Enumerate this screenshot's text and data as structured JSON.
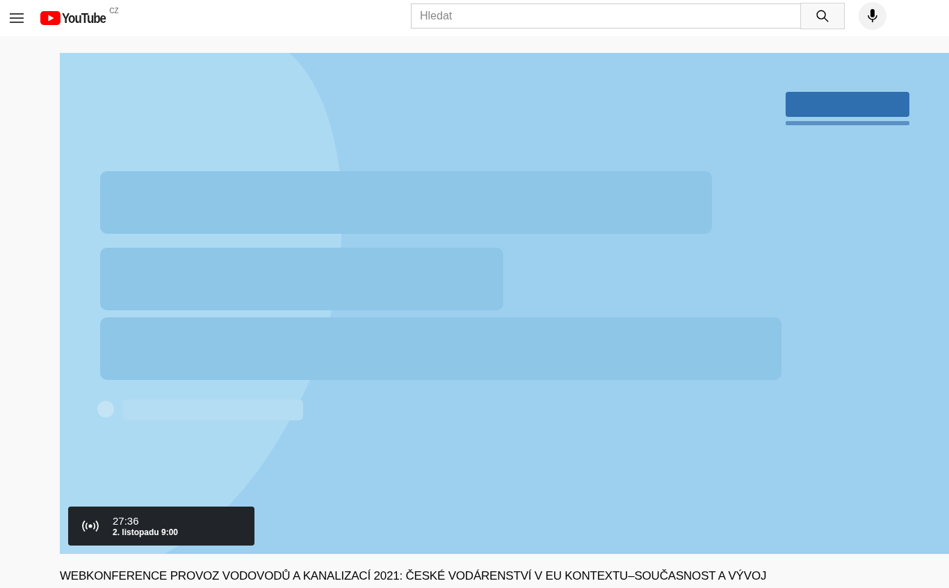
{
  "header": {
    "logo": {
      "wordmark": "YouTube",
      "country": "CZ"
    },
    "search": {
      "placeholder": "Hledat"
    }
  },
  "player": {
    "countdown": {
      "time": "27:36",
      "scheduled": "2. listopadu 9:00"
    }
  },
  "video_title": "WEBKONFERENCE PROVOZ VODOVODŮ A KANALIZACÍ 2021: ČESKÉ VODÁRENSTVÍ V EU KONTEXTU–SOUČASNOST A VÝVOJ"
}
